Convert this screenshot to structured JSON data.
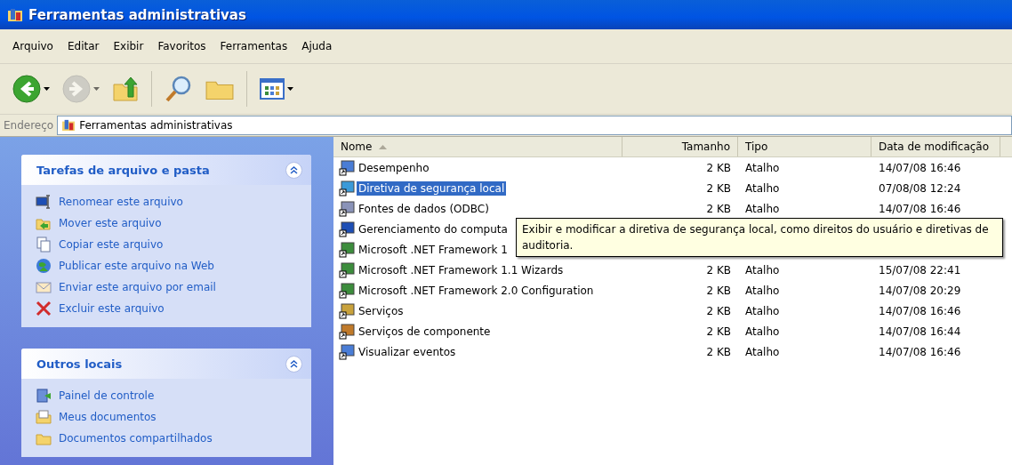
{
  "window": {
    "title": "Ferramentas administrativas"
  },
  "menu": [
    "Arquivo",
    "Editar",
    "Exibir",
    "Favoritos",
    "Ferramentas",
    "Ajuda"
  ],
  "toolbar": [
    {
      "kind": "back",
      "disabled": false,
      "dropdown": true
    },
    {
      "kind": "forward",
      "disabled": true,
      "dropdown": true
    },
    {
      "kind": "up",
      "disabled": false,
      "dropdown": false
    },
    {
      "kind": "separator"
    },
    {
      "kind": "search",
      "disabled": false,
      "dropdown": false
    },
    {
      "kind": "folders",
      "disabled": false,
      "dropdown": false
    },
    {
      "kind": "separator"
    },
    {
      "kind": "views",
      "disabled": false,
      "dropdown": true
    }
  ],
  "address": {
    "label": "Endereço",
    "value": "Ferramentas administrativas"
  },
  "sidebar": [
    {
      "title": "Tarefas de arquivo e pasta",
      "expanded": true,
      "items": [
        {
          "kind": "rename",
          "label": "Renomear este arquivo"
        },
        {
          "kind": "move",
          "label": "Mover este arquivo"
        },
        {
          "kind": "copy",
          "label": "Copiar este arquivo"
        },
        {
          "kind": "web",
          "label": "Publicar este arquivo na Web"
        },
        {
          "kind": "mail",
          "label": "Enviar este arquivo por email"
        },
        {
          "kind": "delete",
          "label": "Excluir este arquivo"
        }
      ]
    },
    {
      "title": "Outros locais",
      "expanded": true,
      "items": [
        {
          "kind": "control",
          "label": "Painel de controle"
        },
        {
          "kind": "docs",
          "label": "Meus documentos"
        },
        {
          "kind": "folder",
          "label": "Documentos compartilhados"
        }
      ]
    }
  ],
  "table": {
    "columns": [
      {
        "label": "Nome",
        "sorted": true
      },
      {
        "label": "Tamanho",
        "sorted": false
      },
      {
        "label": "Tipo",
        "sorted": false
      },
      {
        "label": "Data de modificação",
        "sorted": false
      }
    ],
    "rows": [
      {
        "name": "Desempenho",
        "size": "2 KB",
        "type": "Atalho",
        "date": "14/07/08 16:46",
        "selected": false
      },
      {
        "name": "Diretiva de segurança local",
        "size": "2 KB",
        "type": "Atalho",
        "date": "07/08/08 12:24",
        "selected": true
      },
      {
        "name": "Fontes de dados (ODBC)",
        "size": "2 KB",
        "type": "Atalho",
        "date": "14/07/08 16:46",
        "selected": false
      },
      {
        "name": "Gerenciamento do computa",
        "selected": false
      },
      {
        "name": "Microsoft .NET Framework 1",
        "selected": false
      },
      {
        "name": "Microsoft .NET Framework 1.1 Wizards",
        "size": "2 KB",
        "type": "Atalho",
        "date": "15/07/08 22:41",
        "selected": false
      },
      {
        "name": "Microsoft .NET Framework 2.0 Configuration",
        "size": "2 KB",
        "type": "Atalho",
        "date": "14/07/08 20:29",
        "selected": false
      },
      {
        "name": "Serviços",
        "size": "2 KB",
        "type": "Atalho",
        "date": "14/07/08 16:46",
        "selected": false
      },
      {
        "name": "Serviços de componente",
        "size": "2 KB",
        "type": "Atalho",
        "date": "14/07/08 16:44",
        "selected": false
      },
      {
        "name": "Visualizar eventos",
        "size": "2 KB",
        "type": "Atalho",
        "date": "14/07/08 16:46",
        "selected": false
      }
    ]
  },
  "tooltip": {
    "text": "Exibir e modificar a diretiva de segurança local, como direitos do usuário e diretivas de auditoria."
  }
}
